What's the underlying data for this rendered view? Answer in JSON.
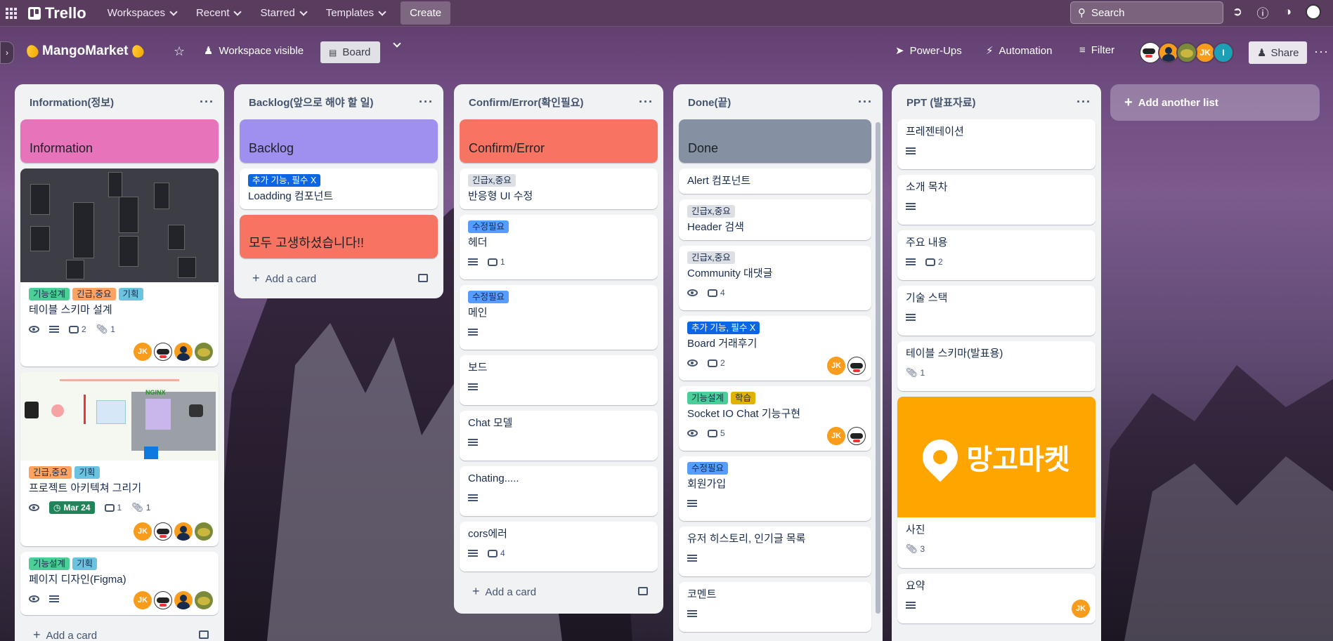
{
  "nav": {
    "brand": "Trello",
    "menus": [
      "Workspaces",
      "Recent",
      "Starred",
      "Templates"
    ],
    "create_label": "Create",
    "search_placeholder": "Search"
  },
  "board": {
    "title": "MangoMarket",
    "visibility": "Workspace visible",
    "view": "Board",
    "power_ups": "Power-Ups",
    "automation": "Automation",
    "filter": "Filter",
    "share": "Share",
    "member_initials": [
      "JK",
      "I"
    ]
  },
  "add_card_label": "Add a card",
  "add_list_label": "Add another list",
  "colors": {
    "green": "#4bce97",
    "orange": "#fea362",
    "teal": "#6cc3e0",
    "blue": "#0c66e4",
    "gray": "#dcdfe4",
    "purple": "#9f8fef",
    "pink": "#e774bb",
    "red": "#f87462",
    "darkgray": "#8590a2",
    "yellow": "#e2b203",
    "date_green": "#1f845a",
    "mango": "#ffa500"
  },
  "lists": [
    {
      "title": "Information(정보)",
      "cards": [
        {
          "title": "Information",
          "cover": "pink"
        },
        {
          "title": "테이블 스키마 설계",
          "labels": [
            "기능설계",
            "긴급,중요",
            "기획"
          ],
          "comments": "2",
          "attachments": "1"
        },
        {
          "title": "프로젝트 아키텍쳐 그리기",
          "labels": [
            "긴급,중요",
            "기획"
          ],
          "date": "Mar 24",
          "comments": "1",
          "attachments": "1"
        },
        {
          "title": "페이지 디자인(Figma)",
          "labels": [
            "기능설계",
            "기획"
          ]
        }
      ],
      "cover_text_arch": "NGINX"
    },
    {
      "title": "Backlog(앞으로 해야 할 일)",
      "cards": [
        {
          "title": "Backlog",
          "cover": "purple"
        },
        {
          "title": "Loadding 컴포넌트",
          "labels": [
            "추가 기능, 필수 X"
          ]
        },
        {
          "title": "모두 고생하셨습니다!!",
          "cover": "red"
        }
      ]
    },
    {
      "title": "Confirm/Error(확인필요)",
      "cards": [
        {
          "title": "Confirm/Error",
          "cover": "red"
        },
        {
          "title": "반응형 UI 수정",
          "labels": [
            "긴급x,중요"
          ]
        },
        {
          "title": "헤더",
          "labels": [
            "수정필요"
          ],
          "comments": "1"
        },
        {
          "title": "메인",
          "labels": [
            "수정필요"
          ]
        },
        {
          "title": "보드"
        },
        {
          "title": "Chat 모델"
        },
        {
          "title": "Chating....."
        },
        {
          "title": "cors에러",
          "comments": "4"
        }
      ]
    },
    {
      "title": "Done(끝)",
      "cards": [
        {
          "title": "Done",
          "cover": "darkgray"
        },
        {
          "title": "Alert 컴포넌트"
        },
        {
          "title": "Header 검색",
          "labels": [
            "긴급x,중요"
          ]
        },
        {
          "title": "Community 대댓글",
          "labels": [
            "긴급x,중요"
          ],
          "comments": "4"
        },
        {
          "title": "Board 거래후기",
          "labels": [
            "추가 기능, 필수 X"
          ],
          "comments": "2"
        },
        {
          "title": "Socket IO Chat 기능구현",
          "labels": [
            "기능설계",
            "학습"
          ],
          "comments": "5"
        },
        {
          "title": "회원가입",
          "labels": [
            "수정필요"
          ]
        },
        {
          "title": "유저 히스토리, 인기글 목록"
        },
        {
          "title": "코멘트"
        }
      ]
    },
    {
      "title": "PPT (발표자료)",
      "cards": [
        {
          "title": "프레젠테이션"
        },
        {
          "title": "소개 목차"
        },
        {
          "title": "주요 내용",
          "comments": "2"
        },
        {
          "title": "기술 스택"
        },
        {
          "title": "테이블 스키마(발표용)",
          "attachments": "1"
        },
        {
          "title": "사진",
          "attachments": "3",
          "cover_text": "망고마켓"
        },
        {
          "title": "요약"
        }
      ]
    }
  ]
}
